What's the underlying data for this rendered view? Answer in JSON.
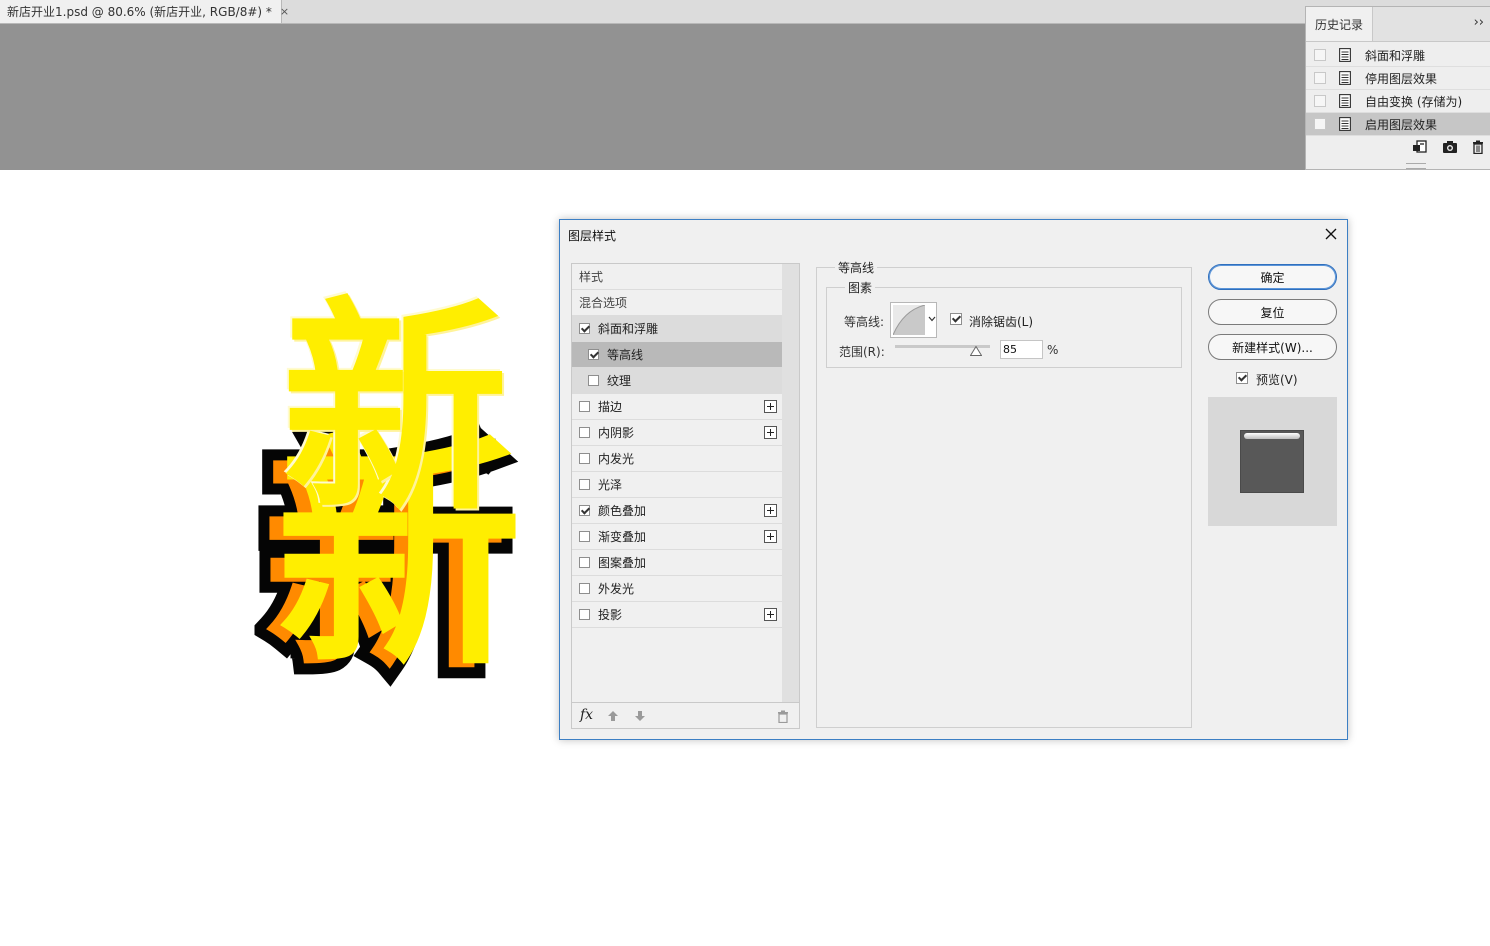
{
  "document": {
    "tab_title": "新店开业1.psd @ 80.6% (新店开业, RGB/8#) *",
    "tab_close": "×",
    "art_front": "新",
    "art_back": "新"
  },
  "history_panel": {
    "tab_label": "历史记录",
    "collapse": "››",
    "items": [
      {
        "label": "斜面和浮雕",
        "active": false
      },
      {
        "label": "停用图层效果",
        "active": false
      },
      {
        "label": "自由变换 (存储为)",
        "active": false
      },
      {
        "label": "启用图层效果",
        "active": true
      }
    ],
    "footer_icons": [
      "new-document-from-state-icon",
      "camera-icon",
      "trash-icon"
    ]
  },
  "dialog": {
    "title": "图层样式",
    "style_list": {
      "header": "样式",
      "blend_options": "混合选项",
      "items": [
        {
          "label": "斜面和浮雕",
          "checked": true,
          "sub": false,
          "plus": false
        },
        {
          "label": "等高线",
          "checked": true,
          "sub": true,
          "plus": false
        },
        {
          "label": "纹理",
          "checked": false,
          "sub": true,
          "plus": false
        },
        {
          "label": "描边",
          "checked": false,
          "sub": false,
          "plus": true
        },
        {
          "label": "内阴影",
          "checked": false,
          "sub": false,
          "plus": true
        },
        {
          "label": "内发光",
          "checked": false,
          "sub": false,
          "plus": false
        },
        {
          "label": "光泽",
          "checked": false,
          "sub": false,
          "plus": false
        },
        {
          "label": "颜色叠加",
          "checked": true,
          "sub": false,
          "plus": true
        },
        {
          "label": "渐变叠加",
          "checked": false,
          "sub": false,
          "plus": true
        },
        {
          "label": "图案叠加",
          "checked": false,
          "sub": false,
          "plus": false
        },
        {
          "label": "外发光",
          "checked": false,
          "sub": false,
          "plus": false
        },
        {
          "label": "投影",
          "checked": false,
          "sub": false,
          "plus": true
        }
      ],
      "fx_label": "fx"
    },
    "contour": {
      "group_title": "等高线",
      "elements_title": "图素",
      "contour_label": "等高线:",
      "anti_alias_label": "消除锯齿(L)",
      "anti_alias_checked": true,
      "range_label": "范围(R):",
      "range_value": "85",
      "range_unit": "%",
      "range_fraction": 0.85
    },
    "buttons": {
      "ok": "确定",
      "reset": "复位",
      "new_style": "新建样式(W)...",
      "preview_label": "预览(V)",
      "preview_checked": true
    }
  },
  "colors": {
    "accent": "#3c7fc4",
    "text_yellow": "#ffee00",
    "text_orange": "#ff8a00",
    "pasteboard": "#929292"
  }
}
